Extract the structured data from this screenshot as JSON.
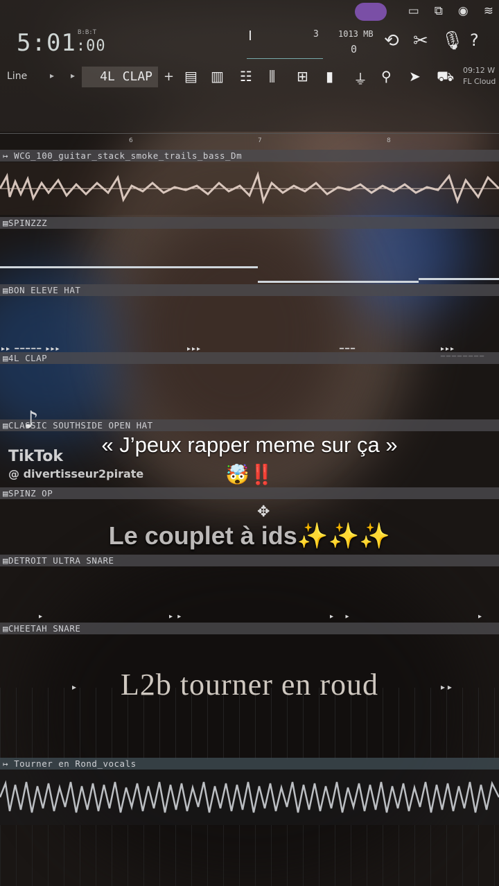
{
  "status_bar": {
    "icons": [
      "screen-record-icon",
      "cast-icon",
      "record-stop-icon",
      "wifi-icon"
    ]
  },
  "toolbar": {
    "time_main": "5:01",
    "time_sub": ":00",
    "beat_label": "B:B:T",
    "cpu_value": "3",
    "memory": "1013 MB",
    "polyphony": "0",
    "pattern_mode": "Line",
    "pattern_name": "4L CLAP",
    "plus": "+",
    "tools": [
      "undo-icon",
      "cut-icon",
      "mic-icon",
      "help-icon"
    ],
    "window_icons": [
      "playlist-icon",
      "piano-roll-icon",
      "channel-rack-icon",
      "mixer-icon",
      "browser-icon",
      "plugin-picker-icon",
      "plugin-icon",
      "tempo-icon",
      "sendto-icon",
      "shop-icon"
    ],
    "cloud_time": "09:12",
    "cloud_label": "FL Cloud",
    "cloud_w": "W"
  },
  "ruler": {
    "marks": [
      "6",
      "7",
      "8"
    ]
  },
  "tracks": [
    {
      "name": "WCG_100_guitar_stack_smoke_trails_bass_Dm",
      "type": "audio"
    },
    {
      "name": "SPINZZZ",
      "type": "pattern"
    },
    {
      "name": "BON ELEVE HAT",
      "type": "pattern"
    },
    {
      "name": "4L CLAP",
      "type": "pattern"
    },
    {
      "name": "CLASSIC SOUTHSIDE OPEN HAT",
      "type": "pattern"
    },
    {
      "name": "SPINZ OP",
      "type": "pattern"
    },
    {
      "name": "DETROIT ULTRA SNARE",
      "type": "pattern"
    },
    {
      "name": "CHEETAH SNARE",
      "type": "pattern"
    },
    {
      "name": "Tourner en Rond_vocals",
      "type": "audio"
    }
  ],
  "overlay": {
    "tiktok_name": "TikTok",
    "tiktok_user": "@ divertisseur2pirate",
    "caption_main": "« J’peux rapper meme sur ça »",
    "caption_emoji": "🤯‼️",
    "caption_couplet": "Le couplet à ids",
    "caption_sparkles": "✨✨✨",
    "caption_song": "L2b tourner en roud"
  }
}
